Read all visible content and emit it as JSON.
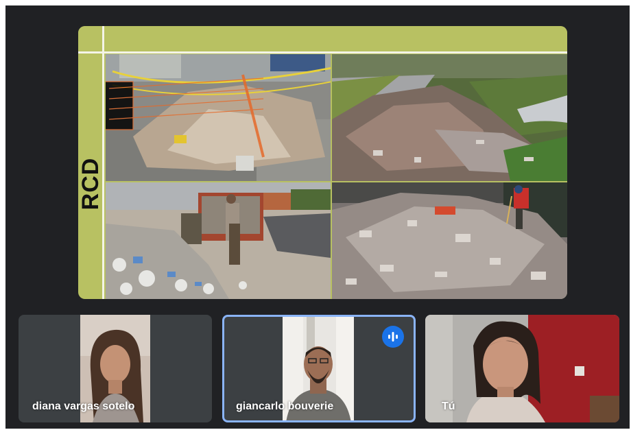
{
  "presentation": {
    "side_title": "RCD",
    "colors": {
      "slide_band": "#b8c162",
      "slide_divider": "#f4f4e8"
    },
    "photos": [
      "construction-debris-fenced-sidewalk",
      "debris-dumped-roadside-river",
      "workers-loading-debris-truck",
      "debris-pile-worker-sweeping"
    ]
  },
  "participants": [
    {
      "name": "diana vargas sotelo",
      "speaking": false
    },
    {
      "name": "giancarlo bouverie",
      "speaking": true
    },
    {
      "name": "Tú",
      "speaking": false
    }
  ],
  "theme": {
    "background": "#202124",
    "tile": "#3c4043",
    "active_border": "#8ab4f8",
    "speaking_badge": "#1a73e8"
  }
}
